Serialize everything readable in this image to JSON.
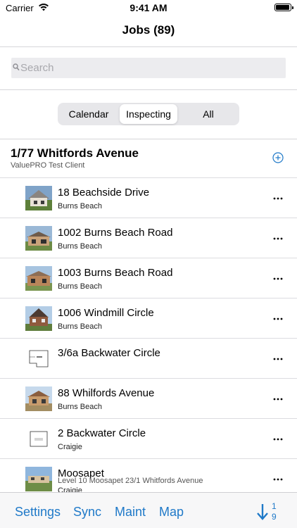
{
  "status_bar": {
    "carrier": "Carrier",
    "time": "9:41 AM"
  },
  "nav": {
    "title": "Jobs (89)"
  },
  "search": {
    "placeholder": "Search",
    "value": ""
  },
  "segments": [
    {
      "label": "Calendar",
      "selected": false
    },
    {
      "label": "Inspecting",
      "selected": true
    },
    {
      "label": "All",
      "selected": false
    }
  ],
  "group": {
    "title": "1/77 Whitfords Avenue",
    "subtitle": "ValuePRO Test Client",
    "add_icon": "plus-circle-icon"
  },
  "jobs": [
    {
      "title": " 18 Beachside Drive",
      "detail": "Burns Beach",
      "thumb": "house-photo"
    },
    {
      "title": "1002 Burns Beach Road",
      "detail": "Burns Beach",
      "thumb": "house-photo"
    },
    {
      "title": "1003 Burns Beach Road",
      "detail": "Burns Beach",
      "thumb": "house-photo"
    },
    {
      "title": "1006 Windmill Circle",
      "detail": "Burns Beach",
      "thumb": "house-photo"
    },
    {
      "title": "3/6a Backwater Circle",
      "detail": "",
      "thumb": "floor-plan"
    },
    {
      "title": "88 Whilfords Avenue",
      "detail": "Burns Beach",
      "thumb": "house-photo"
    },
    {
      "title": "2 Backwater Circle",
      "detail": "Craigie",
      "thumb": "floor-plan"
    },
    {
      "title": "Moosapet",
      "subdetail": "Level 10 Moosapet 23/1 Whitfords Avenue",
      "detail": "Craigie",
      "thumb": "house-photo"
    }
  ],
  "tab_bar": {
    "items": [
      "Settings",
      "Sync",
      "Maint",
      "Map"
    ],
    "sort_top": "1",
    "sort_bottom": "9",
    "accent": "#1f79c8"
  }
}
